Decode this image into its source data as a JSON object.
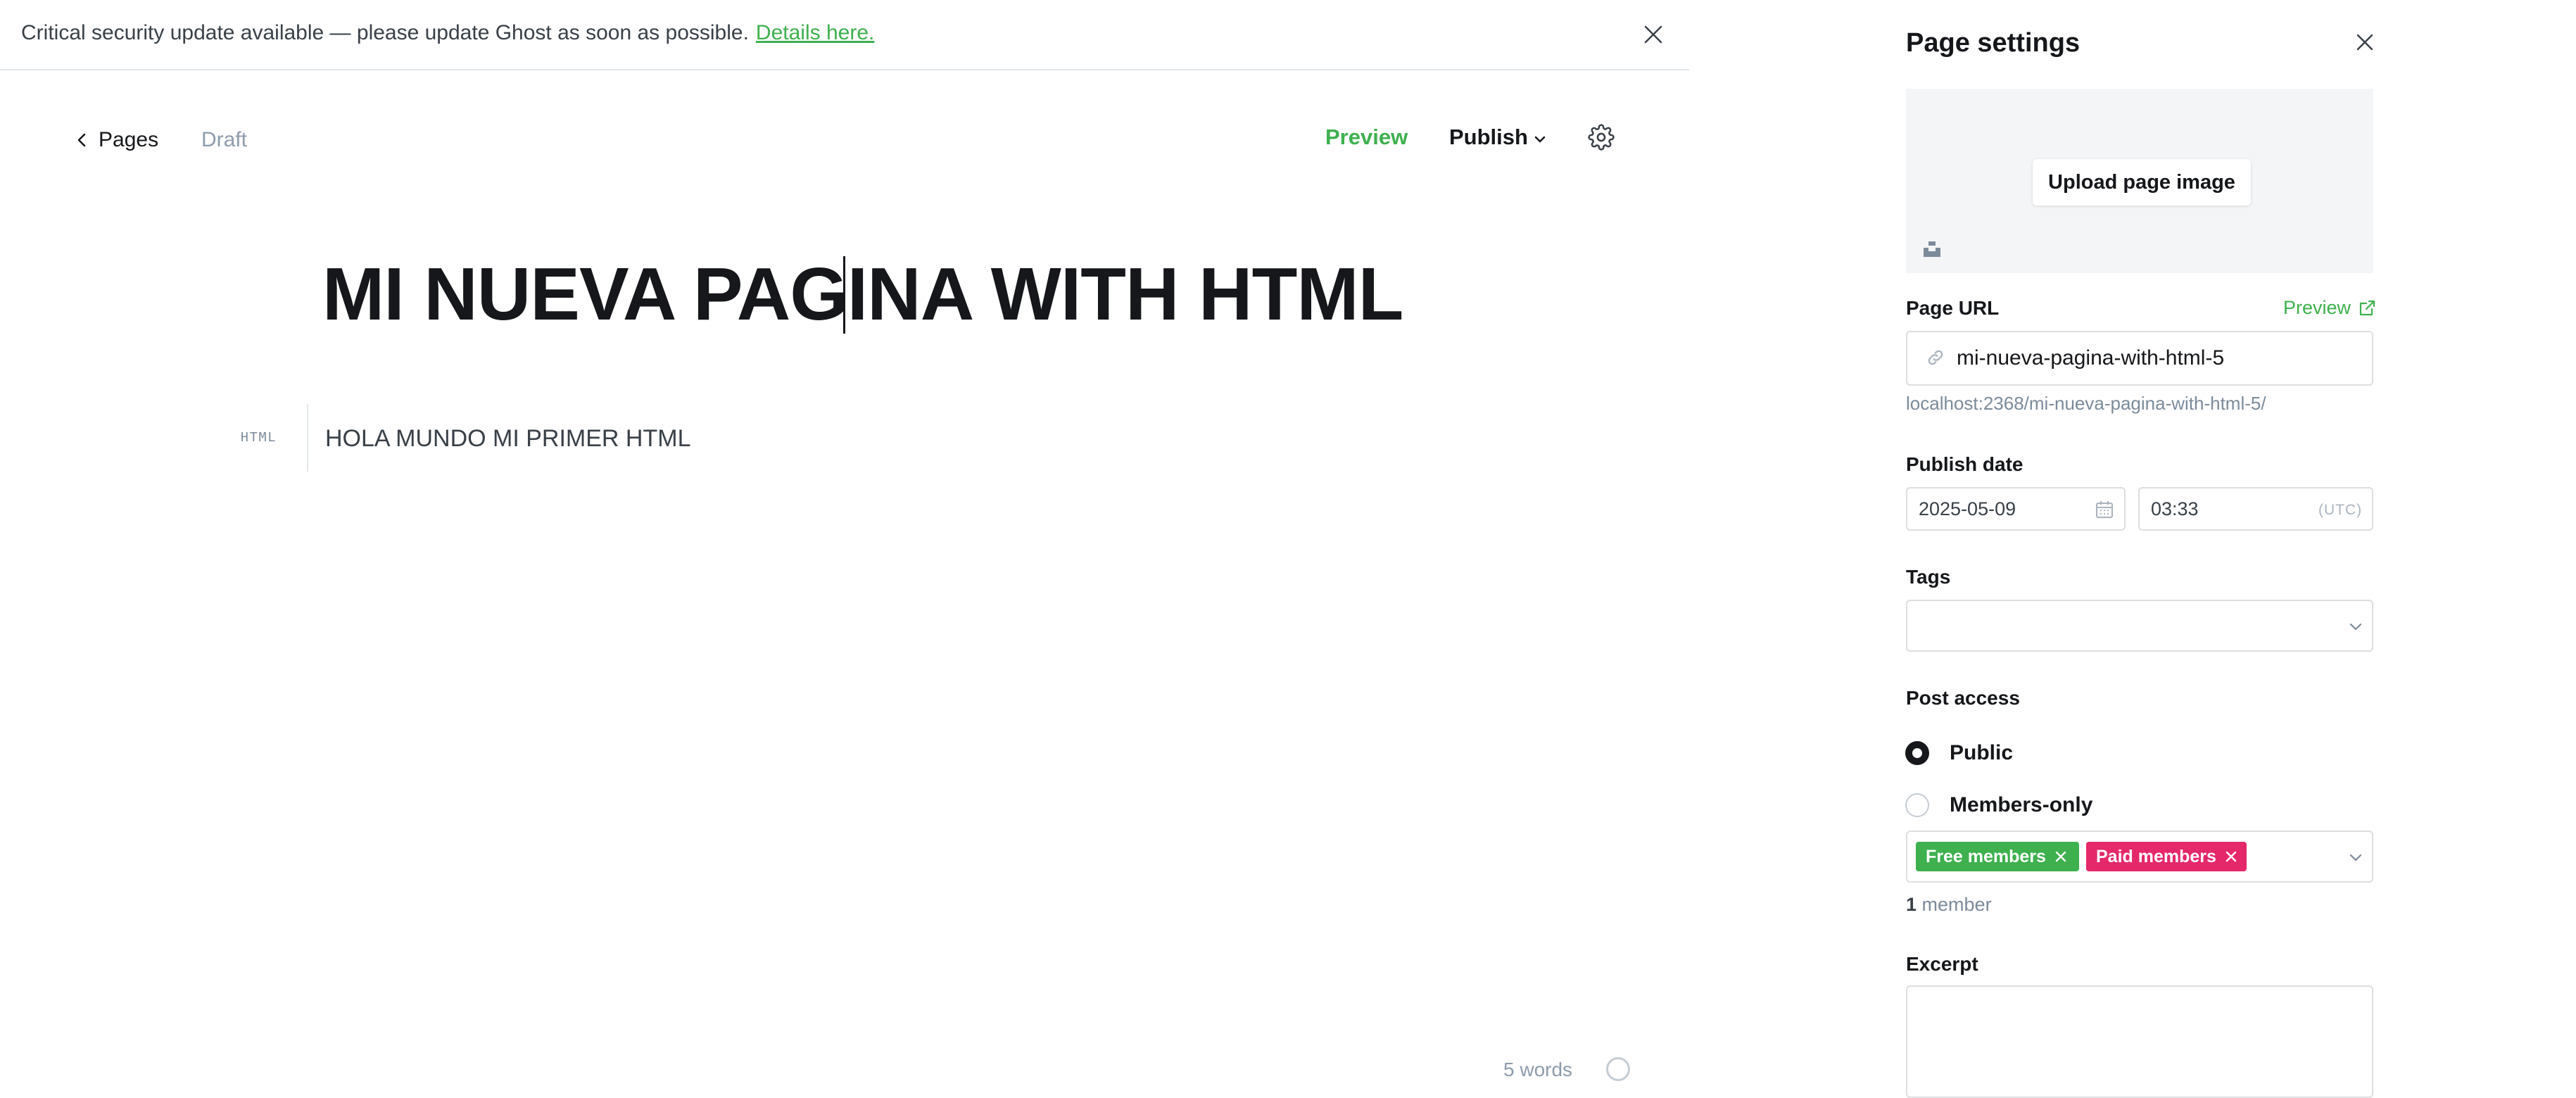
{
  "banner": {
    "message": "Critical security update available — please update Ghost as soon as possible.",
    "link": "Details here."
  },
  "editor": {
    "back_label": "Pages",
    "status": "Draft",
    "preview_label": "Preview",
    "publish_label": "Publish",
    "title": "MI NUEVA PAGINA WITH HTML",
    "html_card_label": "HTML",
    "html_content": "HOLA MUNDO MI PRIMER HTML",
    "word_count": "5 words"
  },
  "settings": {
    "title": "Page settings",
    "upload_label": "Upload page image",
    "page_url_label": "Page URL",
    "preview_link": "Preview",
    "slug": "mi-nueva-pagina-with-html-5",
    "full_url": "localhost:2368/mi-nueva-pagina-with-html-5/",
    "publish_date_label": "Publish date",
    "date": "2025-05-09",
    "time": "03:33",
    "timezone": "(UTC)",
    "tags_label": "Tags",
    "access_label": "Post access",
    "access_options": [
      "Public",
      "Members-only"
    ],
    "selected_access": "Public",
    "segments": [
      "Free members",
      "Paid members"
    ],
    "member_count": "1",
    "member_unit": "member",
    "excerpt_label": "Excerpt"
  },
  "colors": {
    "accent_green": "#3eb04e",
    "paid_pink": "#e5286a",
    "text_dark": "#15171a"
  },
  "icons": [
    "close-icon",
    "chevron-left-icon",
    "chevron-down-icon",
    "gear-icon",
    "unsplash-icon",
    "external-link-icon",
    "link-icon",
    "calendar-icon",
    "help-icon"
  ]
}
